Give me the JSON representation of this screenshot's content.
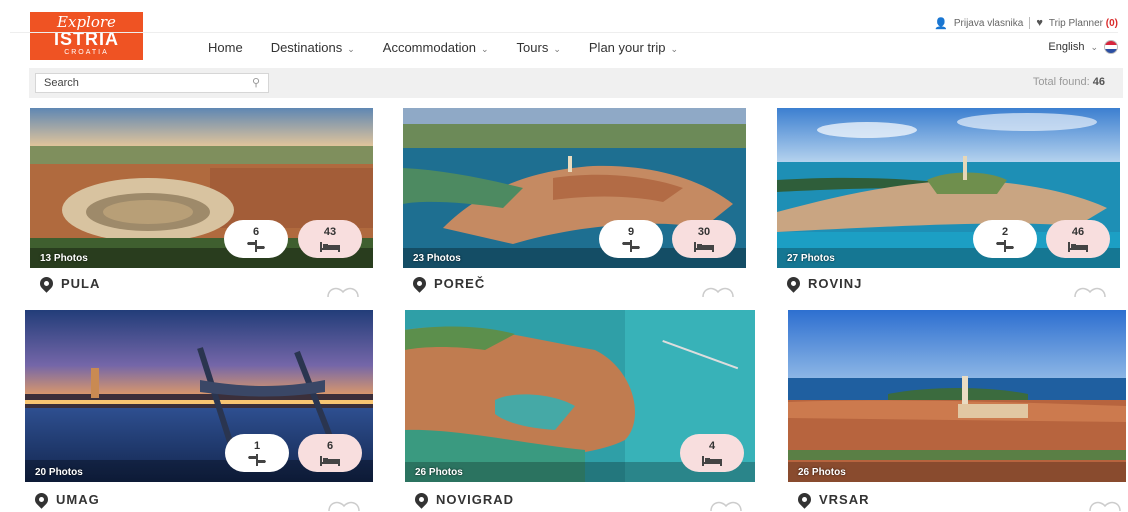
{
  "logo": {
    "line1": "Explore",
    "line2": "ISTRIA",
    "line3": "CROATIA"
  },
  "topbar": {
    "owner_login": "Prijava vlasnika",
    "trip_planner": "Trip Planner",
    "trip_count": "(0)"
  },
  "nav": [
    {
      "label": "Home",
      "chevron": false
    },
    {
      "label": "Destinations",
      "chevron": true
    },
    {
      "label": "Accommodation",
      "chevron": true
    },
    {
      "label": "Tours",
      "chevron": true
    },
    {
      "label": "Plan your trip",
      "chevron": true
    }
  ],
  "language": "English",
  "search": {
    "placeholder": "Search"
  },
  "total": {
    "label": "Total found:",
    "value": "46"
  },
  "icons": [
    "user-icon",
    "heart-icon",
    "search-icon",
    "map-pin-icon",
    "signpost-icon",
    "bed-icon",
    "flag-icon",
    "chevron-down-icon"
  ],
  "colors": {
    "brand": "#ef5323",
    "trip_count": "#d92b2b",
    "acc_badge": "#f8dede"
  },
  "destinations": [
    {
      "name": "PULA",
      "photos": "13 Photos",
      "tours": "6",
      "accommodation": "43"
    },
    {
      "name": "POREČ",
      "photos": "23 Photos",
      "tours": "9",
      "accommodation": "30"
    },
    {
      "name": "ROVINJ",
      "photos": "27 Photos",
      "tours": "2",
      "accommodation": "46"
    },
    {
      "name": "UMAG",
      "photos": "20 Photos",
      "tours": "1",
      "accommodation": "6"
    },
    {
      "name": "NOVIGRAD",
      "photos": "26 Photos",
      "tours": "",
      "accommodation": "4"
    },
    {
      "name": "VRSAR",
      "photos": "26 Photos",
      "tours": "",
      "accommodation": ""
    }
  ]
}
